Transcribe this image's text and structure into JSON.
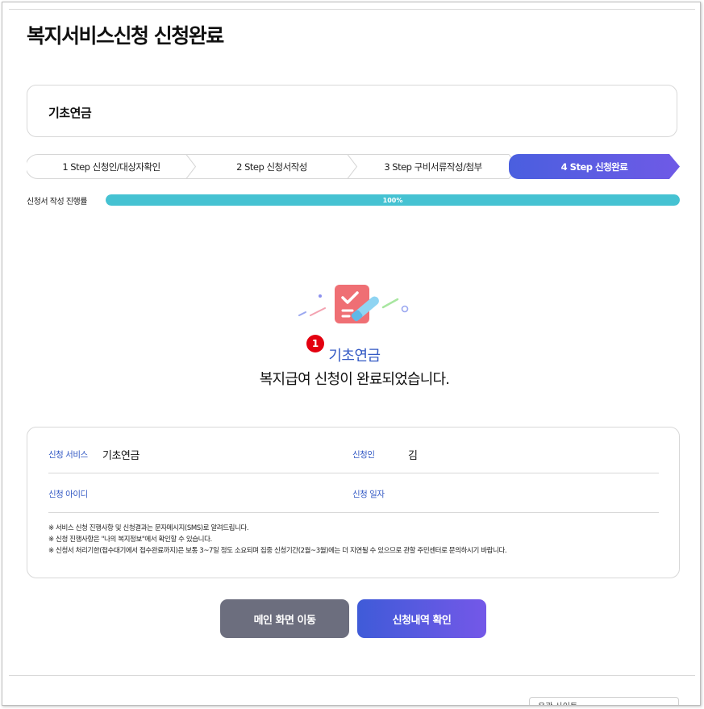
{
  "page": {
    "title": "복지서비스신청 신청완료"
  },
  "service": {
    "name": "기초연금"
  },
  "steps": [
    {
      "label": "1 Step 신청인/대상자확인",
      "active": false
    },
    {
      "label": "2 Step 신청서작성",
      "active": false
    },
    {
      "label": "3 Step 구비서류작성/첨부",
      "active": false
    },
    {
      "label": "4 Step 신청완료",
      "active": true
    }
  ],
  "progress": {
    "label": "신청서 작성 진행률",
    "value": 100,
    "text": "100%"
  },
  "completion": {
    "badge": "1",
    "service_name": "기초연금",
    "message": "복지급여 신청이 완료되었습니다."
  },
  "info": {
    "service_label": "신청 서비스",
    "service_value": "기초연금",
    "applicant_label": "신청인",
    "applicant_value": "김",
    "id_label": "신청 아이디",
    "id_value": "",
    "date_label": "신청 일자",
    "date_value": "",
    "notices": [
      "※ 서비스 신청 진행사항 및 신청결과는 문자메시지(SMS)로 알려드립니다.",
      "※ 신청 진행사항은 \"나의 복지정보\"에서 확인할 수 있습니다.",
      "※ 신청서 처리기한(접수대기에서 접수완료까지)은 보통 3~7일 정도 소요되며 집중 신청기간(2월~3월)에는 더 지연될 수 있으므로 관할 주민센터로 문의하시기 바랍니다."
    ]
  },
  "buttons": {
    "main": "메인 화면 이동",
    "history": "신청내역 확인"
  },
  "footer": {
    "related_sites": "유관 사이트"
  },
  "colors": {
    "accent_blue": "#3359c4",
    "active_step": "#5b5ce0",
    "progress": "#45c2d2",
    "badge": "#e3000f",
    "button_gray": "#6c6e7e"
  },
  "icons": {
    "completion": "checklist-pen-icon"
  }
}
